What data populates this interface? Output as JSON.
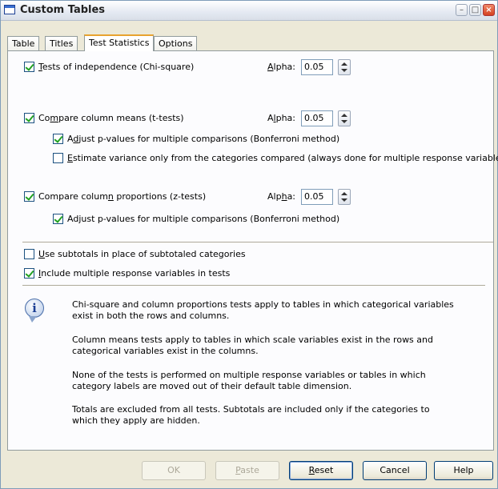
{
  "window": {
    "title": "Custom Tables"
  },
  "tabs": [
    {
      "label": "Table"
    },
    {
      "label": "Titles"
    },
    {
      "label": "Test Statistics"
    },
    {
      "label": "Options"
    }
  ],
  "chi": {
    "label_pre": "",
    "label_u": "T",
    "label_post": "ests of independence (Chi-square)",
    "checked": true,
    "alpha_pre": "",
    "alpha_u": "A",
    "alpha_post": "lpha:",
    "alpha_value": "0.05"
  },
  "means": {
    "label_pre": "Co",
    "label_u": "m",
    "label_post": "pare column means (t-tests)",
    "checked": true,
    "alpha_pre": "A",
    "alpha_u": "l",
    "alpha_post": "pha:",
    "alpha_value": "0.05",
    "adjust": {
      "pre": "A",
      "u": "d",
      "post": "just p-values for multiple comparisons (Bonferroni method)",
      "checked": true
    },
    "estimate": {
      "pre": "",
      "u": "E",
      "post": "stimate variance only from the categories compared (always done for multiple response variables)",
      "checked": false
    }
  },
  "props": {
    "label_pre": "Compare colum",
    "label_u": "n",
    "label_post": " proportions (z-tests)",
    "checked": true,
    "alpha_pre": "Alp",
    "alpha_u": "h",
    "alpha_post": "a:",
    "alpha_value": "0.05",
    "adjust": {
      "label": "Adjust p-values for multiple comparisons (Bonferroni method)",
      "checked": true
    }
  },
  "subtotals": {
    "pre": "",
    "u": "U",
    "post": "se subtotals in place of subtotaled categories",
    "checked": false
  },
  "multiple": {
    "pre": "",
    "u": "I",
    "post": "nclude multiple response variables in tests",
    "checked": true
  },
  "info": {
    "icon": "info-icon",
    "p1": "Chi-square and column proportions tests apply to tables in which categorical variables exist in both the rows and columns.",
    "p2": "Column means tests apply to tables in which scale variables exist in the rows and categorical variables exist in the columns.",
    "p3": "None of the tests is performed on multiple response variables or tables in which category labels are moved out of their default table dimension.",
    "p4": "Totals are excluded from all tests. Subtotals are included only if the categories to which they apply are hidden."
  },
  "buttons": {
    "ok": "OK",
    "paste_u": "P",
    "paste_post": "aste",
    "reset_u": "R",
    "reset_post": "eset",
    "cancel": "Cancel",
    "help": "Help"
  }
}
